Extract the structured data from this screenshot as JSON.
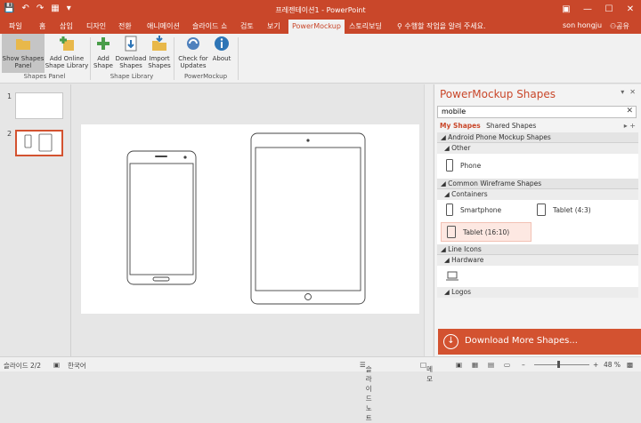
{
  "titlebar": {
    "title": "프레젠테이션1 - PowerPoint"
  },
  "tabs": [
    {
      "label": "파일"
    },
    {
      "label": "홈"
    },
    {
      "label": "삽입"
    },
    {
      "label": "디자인"
    },
    {
      "label": "전환"
    },
    {
      "label": "애니메이션"
    },
    {
      "label": "슬라이드 쇼"
    },
    {
      "label": "검토"
    },
    {
      "label": "보기"
    },
    {
      "label": "PowerMockup"
    },
    {
      "label": "스토리보딩"
    }
  ],
  "tell_me": "수행할 작업을 알려 주세요.",
  "user": "son hongju",
  "share": "공유",
  "ribbon": {
    "show_shapes_panel": "Show Shapes Panel",
    "add_online_shape_library": "Add Online Shape Library",
    "group_shapes_panel": "Shapes Panel",
    "add_shape": "Add Shape",
    "download_shapes": "Download Shapes",
    "import_shapes": "Import Shapes",
    "group_shape_library": "Shape Library",
    "check_updates": "Check for Updates",
    "about": "About",
    "group_powermockup": "PowerMockup"
  },
  "slides": [
    {
      "num": "1"
    },
    {
      "num": "2"
    }
  ],
  "pane": {
    "title": "PowerMockup Shapes",
    "search_value": "mobile",
    "tab_my": "My Shapes",
    "tab_shared": "Shared Shapes",
    "cat1": "Android Phone Mockup Shapes",
    "cat1_sub": "Other",
    "item_phone": "Phone",
    "cat2": "Common Wireframe Shapes",
    "cat2_sub": "Containers",
    "item_smartphone": "Smartphone",
    "item_tablet43": "Tablet (4:3)",
    "item_tablet169": "Tablet (16:10)",
    "cat3": "Line Icons",
    "cat3_sub": "Hardware",
    "cat3_sub2": "Logos"
  },
  "download_more": "Download More Shapes...",
  "status": {
    "slide": "슬라이드 2/2",
    "lang": "한국어",
    "notes": "슬라이드 노트",
    "memo": "메모",
    "zoom": "48 %"
  }
}
